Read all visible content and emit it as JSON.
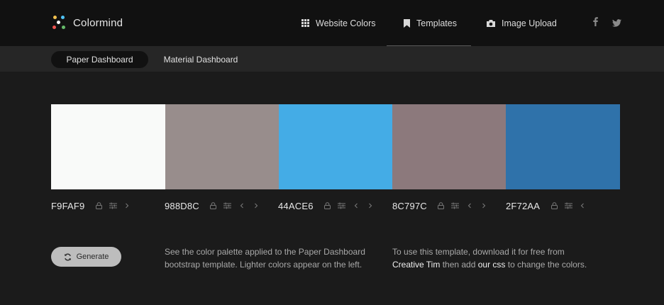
{
  "header": {
    "logo_text": "Colormind",
    "nav": [
      {
        "label": "Website Colors",
        "icon": "grid-icon"
      },
      {
        "label": "Templates",
        "icon": "bookmark-icon"
      },
      {
        "label": "Image Upload",
        "icon": "camera-icon"
      }
    ],
    "active_nav": "Templates",
    "social": [
      "facebook-icon",
      "twitter-icon"
    ]
  },
  "subnav": {
    "tabs": [
      "Paper Dashboard",
      "Material Dashboard"
    ],
    "active_tab": "Paper Dashboard"
  },
  "palette": [
    {
      "hex": "F9FAF9",
      "color": "#F9FAF9"
    },
    {
      "hex": "988D8C",
      "color": "#988D8C"
    },
    {
      "hex": "44ACE6",
      "color": "#44ACE6"
    },
    {
      "hex": "8C797C",
      "color": "#8C797C"
    },
    {
      "hex": "2F72AA",
      "color": "#2F72AA"
    }
  ],
  "generate_label": "Generate",
  "description": {
    "line1": "See the color palette applied to the Paper Dashboard",
    "line2": "bootstrap template. Lighter colors appear on the left."
  },
  "instructions": {
    "line1": "To use this template, download it for free from",
    "link1": "Creative Tim",
    "mid": " then add ",
    "link2": "our css",
    "end": " to change the colors."
  }
}
